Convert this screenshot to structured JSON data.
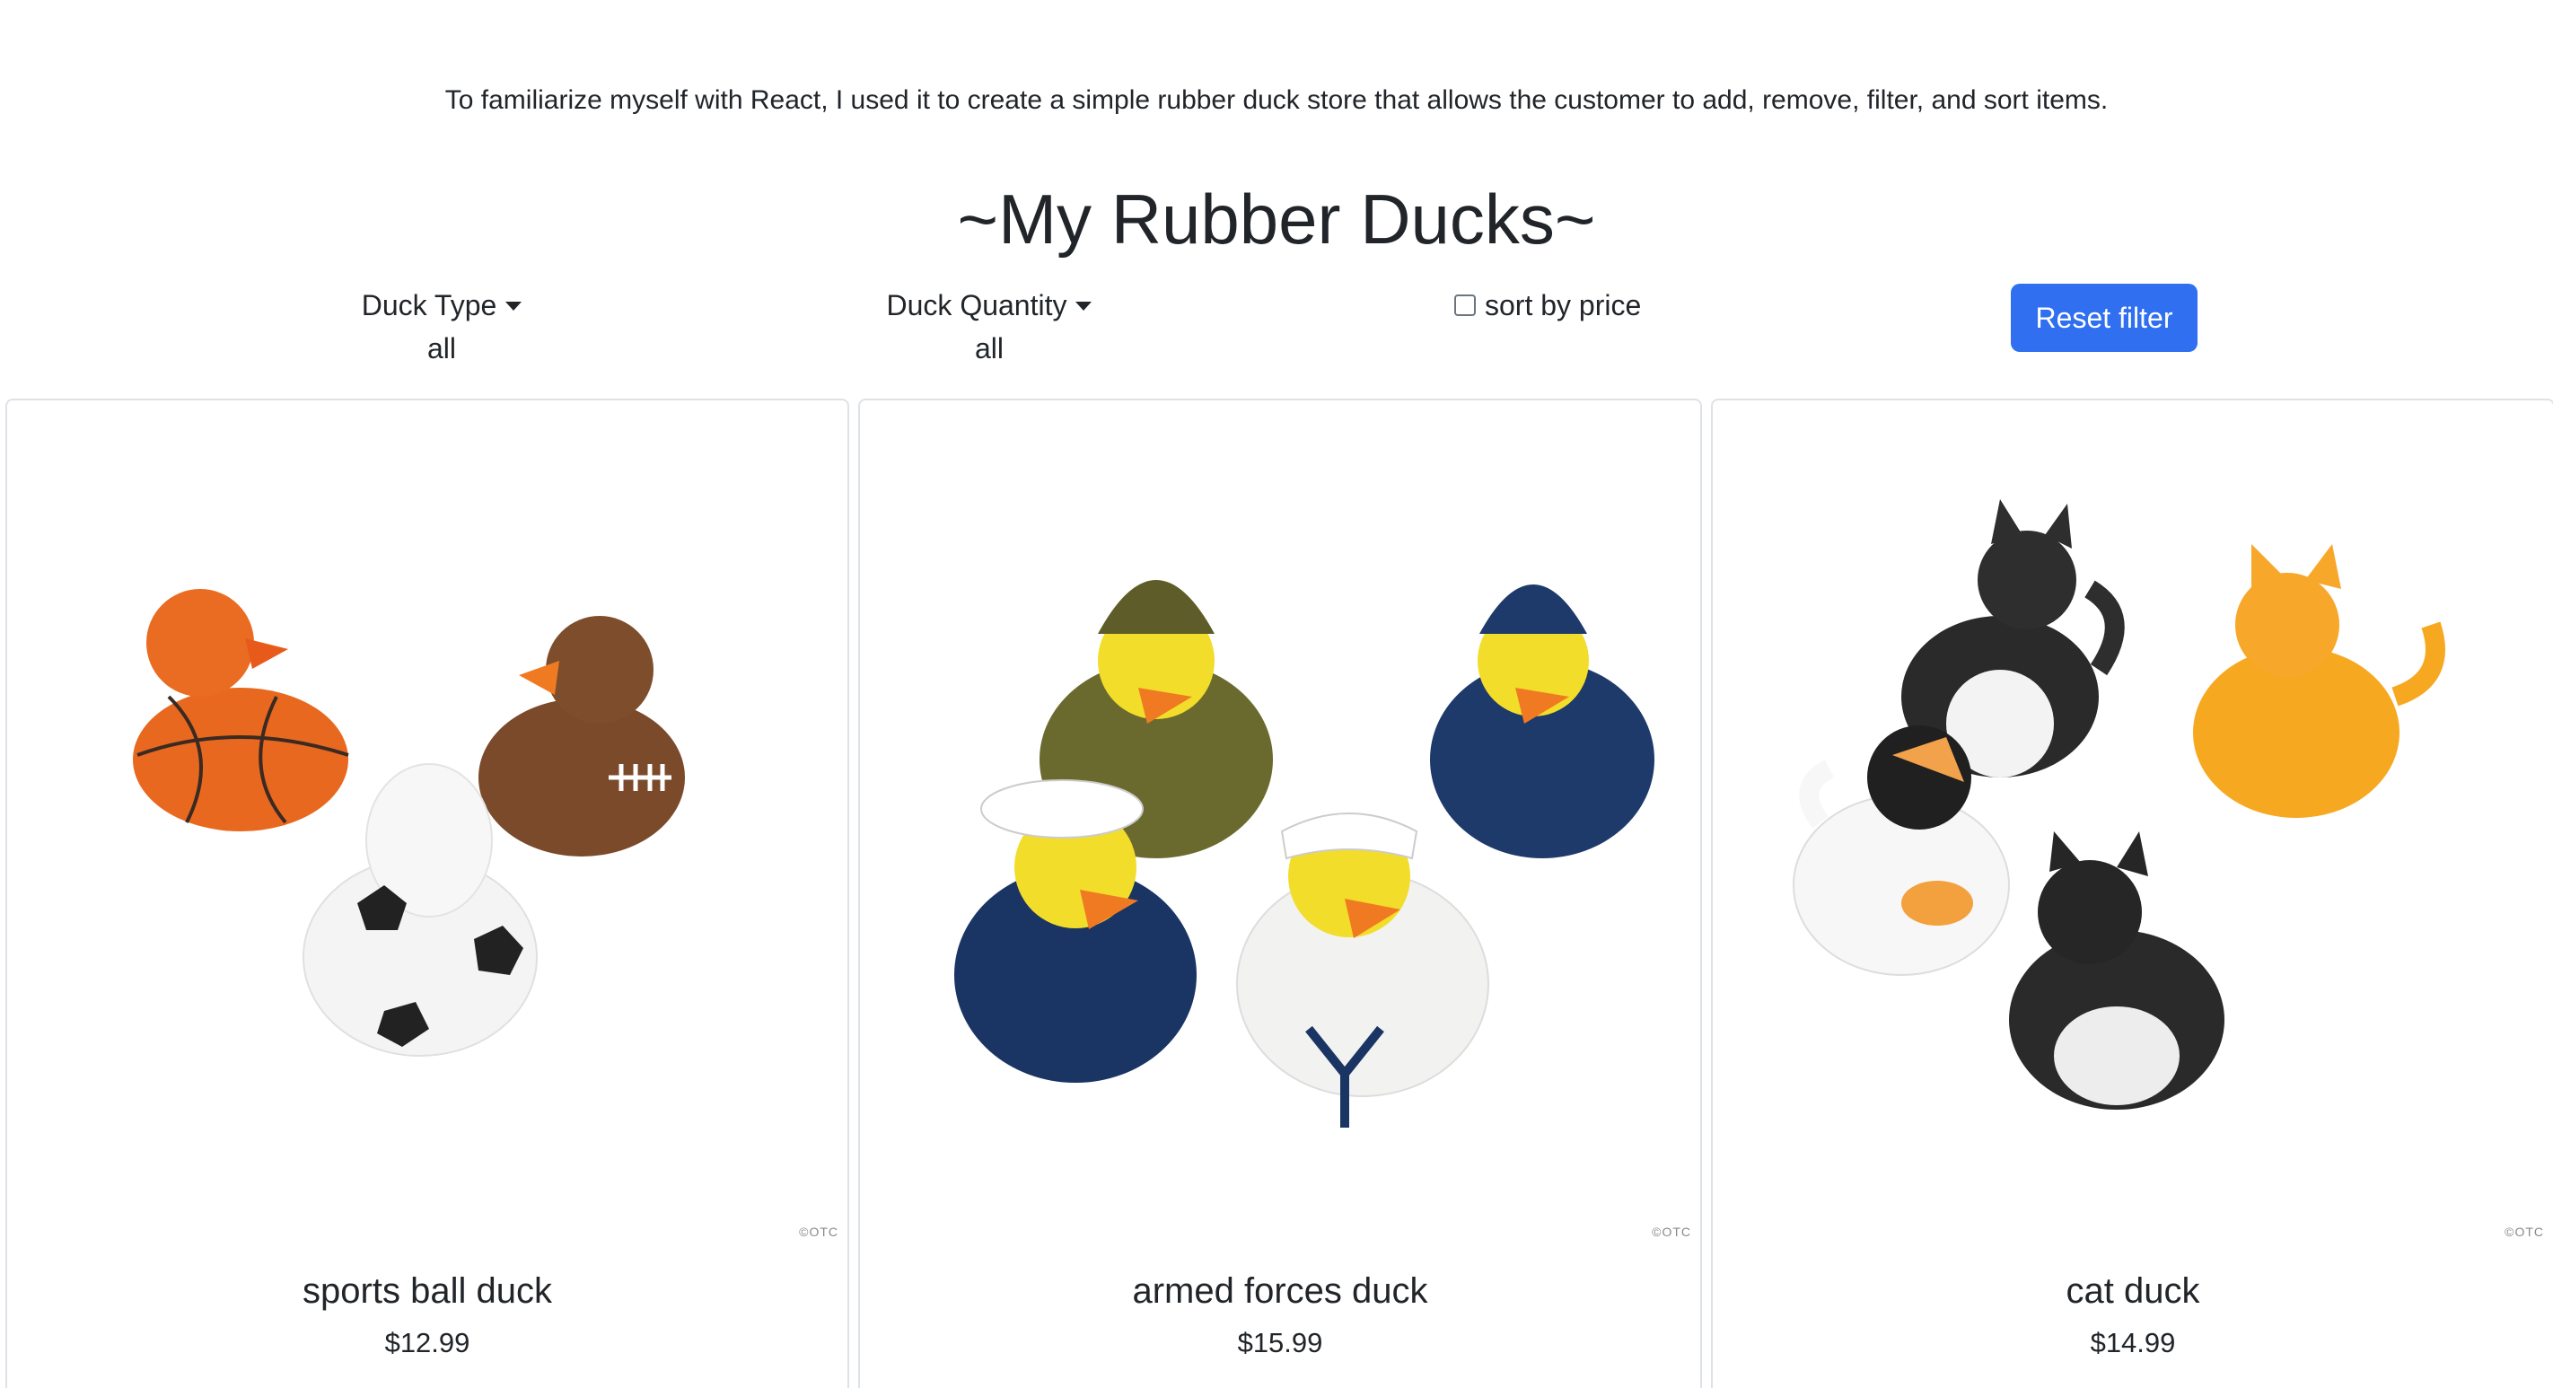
{
  "intro": "To familiarize myself with React, I used it to create a simple rubber duck store that allows the customer to add, remove, filter, and sort items.",
  "title": "~My Rubber Ducks~",
  "filters": {
    "type_label": "Duck Type",
    "type_value": "all",
    "quantity_label": "Duck Quantity",
    "quantity_value": "all",
    "sort_label": "sort by price",
    "sort_checked": false,
    "reset_label": "Reset filter"
  },
  "colors": {
    "accent": "#2f6ff0",
    "text": "#212529",
    "card_border": "#dee2e6"
  },
  "products": [
    {
      "name": "sports ball duck",
      "price": "$12.99",
      "watermark": "©OTC"
    },
    {
      "name": "armed forces duck",
      "price": "$15.99",
      "watermark": "©OTC"
    },
    {
      "name": "cat duck",
      "price": "$14.99",
      "watermark": "©OTC"
    }
  ]
}
